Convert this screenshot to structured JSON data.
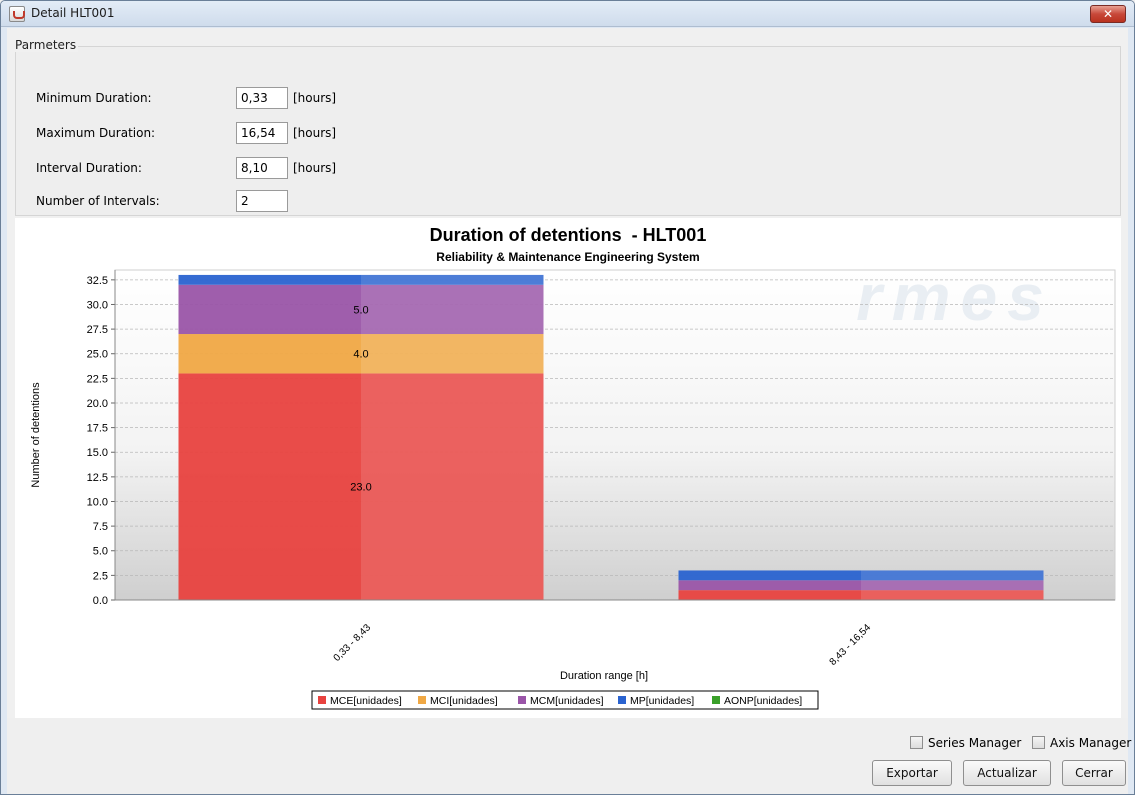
{
  "window": {
    "title": "Detail HLT001",
    "close_glyph": "✕"
  },
  "params": {
    "legend": "Parmeters",
    "rows": [
      {
        "label": "Minimum Duration:",
        "value": "0,33",
        "unit": "[hours]"
      },
      {
        "label": "Maximum Duration:",
        "value": "16,54",
        "unit": "[hours]"
      },
      {
        "label": "Interval Duration:",
        "value": "8,10",
        "unit": "[hours]"
      },
      {
        "label": "Number of Intervals:",
        "value": "2",
        "unit": ""
      }
    ]
  },
  "chart_data": {
    "type": "bar",
    "stacked": true,
    "title": "Duration of detentions  - HLT001",
    "subtitle": "Reliability & Maintenance Engineering System",
    "xlabel": "Duration range [h]",
    "ylabel": "Number of detentions",
    "watermark": "rmes",
    "categories": [
      "0,33 - 8,43",
      "8,43 - 16,54"
    ],
    "ylim": [
      0,
      33.5
    ],
    "yticks": [
      "0.0",
      "2.5",
      "5.0",
      "7.5",
      "10.0",
      "12.5",
      "15.0",
      "17.5",
      "20.0",
      "22.5",
      "25.0",
      "27.5",
      "30.0",
      "32.5"
    ],
    "grid": true,
    "legend_position": "bottom",
    "series": [
      {
        "name": "MCE[unidades]",
        "color": "#e8423f",
        "values": [
          23,
          1
        ],
        "labels": [
          "23.0",
          ""
        ]
      },
      {
        "name": "MCI[unidades]",
        "color": "#f0a844",
        "values": [
          4,
          0
        ],
        "labels": [
          "4.0",
          ""
        ]
      },
      {
        "name": "MCM[unidades]",
        "color": "#9a55a8",
        "values": [
          5,
          1
        ],
        "labels": [
          "5.0",
          ""
        ]
      },
      {
        "name": "MP[unidades]",
        "color": "#2a63d0",
        "values": [
          1,
          1
        ],
        "labels": [
          "",
          ""
        ]
      },
      {
        "name": "AONP[unidades]",
        "color": "#3aa02a",
        "values": [
          0,
          0
        ],
        "labels": [
          "",
          ""
        ]
      }
    ]
  },
  "footer": {
    "series_manager": "Series Manager",
    "axis_manager": "Axis Manager",
    "export_label": "Exportar",
    "update_label": "Actualizar",
    "close_label": "Cerrar"
  }
}
